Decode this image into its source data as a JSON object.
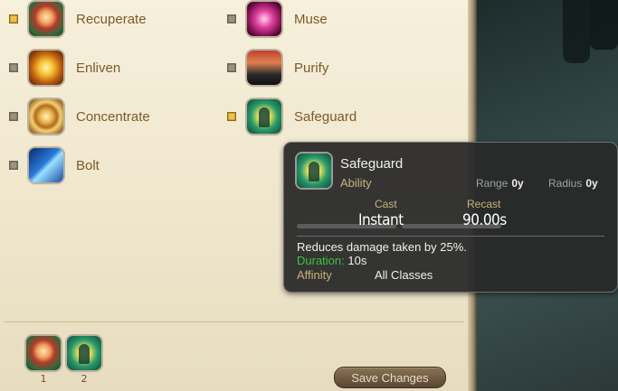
{
  "actions": [
    {
      "label": "Recuperate",
      "icon": "recuperate-icon",
      "checked": true
    },
    {
      "label": "Enliven",
      "icon": "enliven-icon",
      "checked": false
    },
    {
      "label": "Concentrate",
      "icon": "concentrate-icon",
      "checked": false
    },
    {
      "label": "Bolt",
      "icon": "bolt-icon",
      "checked": false
    },
    {
      "label": "Muse",
      "icon": "muse-icon",
      "checked": false
    },
    {
      "label": "Purify",
      "icon": "purify-icon",
      "checked": false
    },
    {
      "label": "Safeguard",
      "icon": "safeguard-icon",
      "checked": true
    }
  ],
  "hotbar": [
    {
      "num": "1",
      "icon": "recuperate-icon"
    },
    {
      "num": "2",
      "icon": "safeguard-icon"
    }
  ],
  "save_button": "Save Changes",
  "tooltip": {
    "name": "Safeguard",
    "type": "Ability",
    "range_label": "Range",
    "range_value": "0y",
    "radius_label": "Radius",
    "radius_value": "0y",
    "cast_label": "Cast",
    "cast_value": "Instant",
    "recast_label": "Recast",
    "recast_value": "90.00s",
    "description": "Reduces damage taken by 25%.",
    "duration_label": "Duration:",
    "duration_value": "10s",
    "affinity_label": "Affinity",
    "affinity_value": "All Classes"
  },
  "colors": {
    "checkbox_on": "#f0c040",
    "label_text": "#7b5a28",
    "duration_green": "#3ec23e"
  }
}
